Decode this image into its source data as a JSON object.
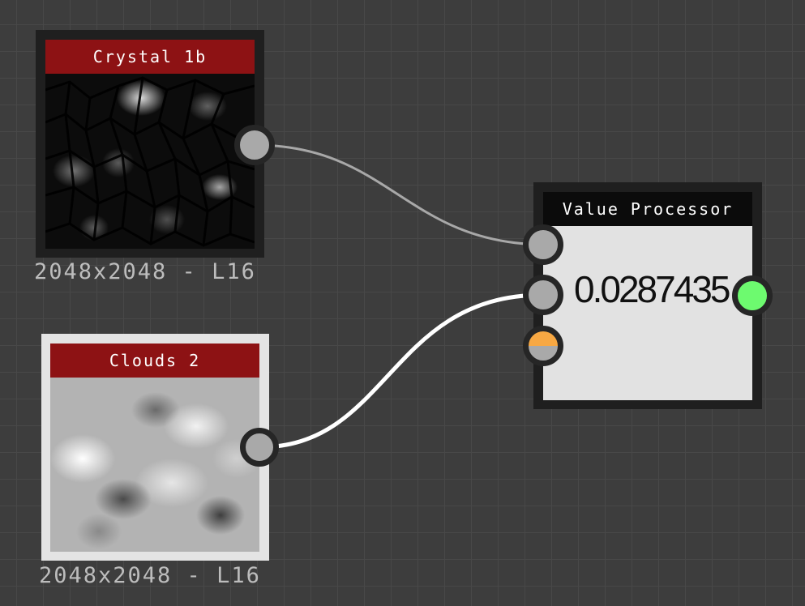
{
  "nodes": {
    "crystal": {
      "title": "Crystal 1b",
      "resolution": "2048x2048 - L16"
    },
    "clouds": {
      "title": "Clouds 2",
      "resolution": "2048x2048 - L16"
    },
    "value_processor": {
      "title": "Value Processor",
      "value": "0.0287435"
    }
  },
  "colors": {
    "canvas_bg": "#3d3d3d",
    "grid_line": "#484848",
    "node_title_red": "#8d1214",
    "node_title_black": "#0b0b0b",
    "port_gray": "#a9a9a9",
    "port_orange": "#f7a843",
    "port_green": "#6dfa6f",
    "wire_gray": "#a8a8a8",
    "wire_white": "#ffffff"
  }
}
